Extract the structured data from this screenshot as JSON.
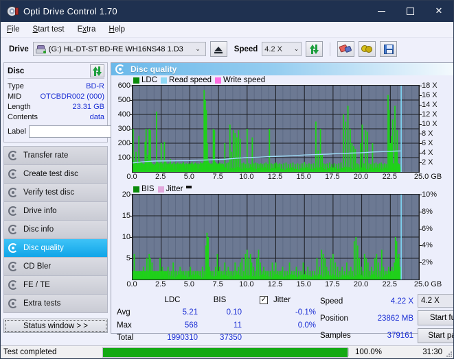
{
  "window": {
    "title": "Opti Drive Control 1.70",
    "icon": "disc-icon",
    "minimize": "–",
    "maximize": "□",
    "close": "✕"
  },
  "menu": {
    "items": [
      {
        "label": "File",
        "accel": "F"
      },
      {
        "label": "Start test",
        "accel": "S"
      },
      {
        "label": "Extra",
        "accel": "x"
      },
      {
        "label": "Help",
        "accel": "H"
      }
    ]
  },
  "toolbar": {
    "drive_label": "Drive",
    "drive_value": "(G:)  HL-DT-ST BD-RE  WH16NS48 1.D3",
    "eject_icon": "eject-icon",
    "speed_label": "Speed",
    "speed_value": "4.2 X",
    "refresh_icon": "refresh-icon",
    "erase_icon": "eraser-icon",
    "coins_icon": "coins-icon",
    "save_icon": "save-icon",
    "caret": "⌄"
  },
  "disc": {
    "header": "Disc",
    "refresh_icon": "refresh-icon",
    "fields": [
      {
        "key": "Type",
        "value": "BD-R"
      },
      {
        "key": "MID",
        "value": "OTCBDR002 (000)"
      },
      {
        "key": "Length",
        "value": "23.31 GB"
      },
      {
        "key": "Contents",
        "value": "data"
      }
    ],
    "label_key": "Label",
    "label_value": "",
    "label_placeholder": "",
    "disc_button_icon": "cd-icon"
  },
  "nav": {
    "items": [
      {
        "label": "Transfer rate",
        "selected": false
      },
      {
        "label": "Create test disc",
        "selected": false
      },
      {
        "label": "Verify test disc",
        "selected": false
      },
      {
        "label": "Drive info",
        "selected": false
      },
      {
        "label": "Disc info",
        "selected": false
      },
      {
        "label": "Disc quality",
        "selected": true
      },
      {
        "label": "CD Bler",
        "selected": false
      },
      {
        "label": "FE / TE",
        "selected": false
      },
      {
        "label": "Extra tests",
        "selected": false
      }
    ],
    "status_window": "Status window > >"
  },
  "panel": {
    "title": "Disc quality",
    "icon": "disc-quality-icon"
  },
  "chart_data": [
    {
      "type": "line",
      "title": "LDC / Read speed",
      "xlabel": "GB",
      "ylabel": "LDC",
      "y2label": "X",
      "xlim": [
        0,
        25
      ],
      "ylim": [
        0,
        600
      ],
      "y2lim": [
        0,
        18
      ],
      "grid": true,
      "legend_position": "top-left",
      "legend": [
        {
          "name": "LDC",
          "color": "#0a8a0a"
        },
        {
          "name": "Read speed",
          "color": "#8fd8f4"
        },
        {
          "name": "Write speed",
          "color": "#ff6ee0"
        }
      ],
      "xticks": [
        "0.0",
        "2.5",
        "5.0",
        "7.5",
        "10.0",
        "12.5",
        "15.0",
        "17.5",
        "20.0",
        "22.5",
        "25.0"
      ],
      "yticks": [
        100,
        200,
        300,
        400,
        500,
        600
      ],
      "y2ticks": [
        "2 X",
        "4 X",
        "6 X",
        "8 X",
        "10 X",
        "12 X",
        "14 X",
        "16 X",
        "18 X"
      ],
      "series": [
        {
          "name": "LDC",
          "color": "#1fd119",
          "render": "vertical-bars",
          "x": [
            0.05,
            0.12,
            0.2,
            0.3,
            0.38,
            0.45,
            0.55,
            0.62,
            0.72,
            0.8,
            0.9,
            1.0,
            1.1,
            1.18,
            1.25,
            1.35,
            1.45,
            1.55,
            1.62,
            1.7,
            1.8,
            1.9,
            2.0,
            2.1,
            2.2,
            2.3,
            2.42,
            2.5,
            2.55,
            2.65,
            2.78,
            2.9,
            3.0,
            3.1,
            3.2,
            3.3,
            3.4,
            3.5,
            3.62,
            3.72,
            3.85,
            3.95,
            4.05,
            4.15,
            4.25,
            4.35,
            4.45,
            4.55,
            4.68,
            4.78,
            4.9,
            5.0,
            5.1,
            5.2,
            5.3,
            5.42,
            5.5,
            5.6,
            5.72,
            5.85,
            5.95,
            6.05,
            6.15,
            6.25,
            6.35,
            6.45,
            6.52,
            6.58,
            6.65,
            6.75,
            6.85,
            6.95,
            7.05,
            7.15,
            7.25,
            7.35,
            7.45,
            7.55,
            7.62,
            7.72,
            7.82,
            7.92,
            8.05,
            8.2,
            8.35,
            8.5,
            8.65,
            8.8,
            8.95,
            9.1,
            9.25,
            9.4,
            9.55,
            9.7,
            9.85,
            10.0,
            10.15,
            10.3,
            10.45,
            10.6,
            10.75,
            10.9,
            11.05,
            11.2,
            11.35,
            11.5,
            11.65,
            11.8,
            11.95,
            12.1,
            12.25,
            12.4,
            12.55,
            12.7,
            12.85,
            13.0,
            13.2,
            13.4,
            13.6,
            13.8,
            14.0,
            14.2,
            14.4,
            14.6,
            14.8,
            15.0,
            15.2,
            15.4,
            15.6,
            15.8,
            16.0,
            16.2,
            16.4,
            16.55,
            16.7,
            16.85,
            17.0,
            17.2,
            17.4,
            17.6,
            17.8,
            18.0,
            18.2,
            18.4,
            18.6,
            18.8,
            19.0,
            19.15,
            19.3,
            19.45,
            19.6,
            19.75,
            19.9,
            20.05,
            20.2,
            20.35,
            20.5,
            20.65,
            20.8,
            20.95,
            21.1,
            21.25,
            21.4,
            21.55,
            21.7,
            21.85,
            22.0,
            22.15,
            22.3,
            22.4,
            22.5,
            22.6,
            22.7,
            22.8,
            22.9,
            23.0,
            23.1,
            23.2,
            23.3,
            23.4
          ],
          "values": [
            300,
            80,
            60,
            140,
            70,
            55,
            250,
            90,
            65,
            70,
            60,
            55,
            210,
            300,
            80,
            120,
            300,
            290,
            70,
            60,
            55,
            50,
            60,
            420,
            70,
            60,
            65,
            200,
            55,
            60,
            210,
            80,
            60,
            55,
            60,
            90,
            55,
            60,
            70,
            55,
            60,
            65,
            55,
            60,
            55,
            60,
            70,
            55,
            60,
            55,
            60,
            55,
            60,
            70,
            55,
            60,
            65,
            55,
            60,
            55,
            70,
            60,
            65,
            570,
            500,
            430,
            200,
            90,
            65,
            60,
            55,
            60,
            300,
            290,
            70,
            60,
            55,
            60,
            65,
            55,
            60,
            55,
            200,
            60,
            65,
            330,
            140,
            290,
            270,
            240,
            290,
            230,
            60,
            65,
            55,
            300,
            60,
            55,
            240,
            60,
            65,
            60,
            55,
            60,
            55,
            60,
            65,
            55,
            300,
            60,
            55,
            60,
            65,
            55,
            60,
            55,
            60,
            65,
            55,
            60,
            65,
            55,
            60,
            55,
            60,
            70,
            55,
            60,
            55,
            60,
            350,
            150,
            300,
            120,
            60,
            55,
            60,
            65,
            55,
            60,
            55,
            60,
            65,
            400,
            350,
            460,
            300,
            200,
            180,
            160,
            60,
            55,
            200,
            330,
            60,
            290,
            280,
            60,
            55,
            200,
            60,
            65,
            55,
            60,
            65,
            55,
            60,
            55,
            535,
            430,
            200,
            250,
            365,
            60,
            460,
            150,
            290,
            60,
            55
          ]
        },
        {
          "name": "Read speed",
          "color": "#9fdcf7",
          "render": "line",
          "x": [
            0.0,
            1.0,
            2.0,
            3.0,
            4.0,
            5.0,
            6.0,
            7.0,
            8.0,
            9.0,
            10.0,
            11.0,
            12.0,
            13.0,
            14.0,
            15.0,
            16.0,
            17.0,
            18.0,
            19.0,
            20.0,
            21.0,
            22.0,
            23.0,
            23.45
          ],
          "values": [
            63,
            72,
            76,
            77,
            78,
            79,
            82,
            85,
            88,
            95,
            100,
            103,
            107,
            110,
            113,
            118,
            121,
            124,
            128,
            131,
            134,
            139,
            142,
            145,
            146
          ]
        },
        {
          "name": "Scan cursor",
          "color": "#7fd9f7",
          "render": "vline",
          "x": [
            23.45
          ]
        }
      ]
    },
    {
      "type": "line",
      "title": "BIS / Jitter",
      "xlabel": "GB",
      "ylabel": "BIS",
      "y2label": "%",
      "xlim": [
        0,
        25
      ],
      "ylim": [
        0,
        20
      ],
      "y2lim": [
        0,
        10
      ],
      "grid": true,
      "legend_position": "top-left",
      "legend": [
        {
          "name": "BIS",
          "color": "#0a8a0a"
        },
        {
          "name": "Jitter",
          "color": "#e2a8dc"
        }
      ],
      "xticks": [
        "0.0",
        "2.5",
        "5.0",
        "7.5",
        "10.0",
        "12.5",
        "15.0",
        "17.5",
        "20.0",
        "22.5",
        "25.0"
      ],
      "yticks": [
        5,
        10,
        15,
        20
      ],
      "y2ticks": [
        "2%",
        "4%",
        "6%",
        "8%",
        "10%"
      ],
      "series": [
        {
          "name": "BIS",
          "color": "#1fd119",
          "render": "vertical-bars",
          "x": [
            0.05,
            0.15,
            0.25,
            0.35,
            0.45,
            0.55,
            0.65,
            0.75,
            0.85,
            0.95,
            1.05,
            1.15,
            1.25,
            1.35,
            1.45,
            1.55,
            1.62,
            1.7,
            1.8,
            1.9,
            2.0,
            2.1,
            2.2,
            2.3,
            2.4,
            2.5,
            2.6,
            2.7,
            2.8,
            2.9,
            3.0,
            3.1,
            3.25,
            3.4,
            3.55,
            3.7,
            3.85,
            4.0,
            4.15,
            4.3,
            4.45,
            4.6,
            4.75,
            4.9,
            5.05,
            5.2,
            5.35,
            5.5,
            5.65,
            5.8,
            5.95,
            6.1,
            6.25,
            6.4,
            6.5,
            6.55,
            6.6,
            6.7,
            6.8,
            6.95,
            7.1,
            7.25,
            7.4,
            7.5,
            7.6,
            7.75,
            7.9,
            8.05,
            8.2,
            8.35,
            8.5,
            8.65,
            8.8,
            8.95,
            9.1,
            9.25,
            9.4,
            9.55,
            9.7,
            9.85,
            10.0,
            10.15,
            10.3,
            10.4,
            10.55,
            10.7,
            10.85,
            11.0,
            11.15,
            11.3,
            11.45,
            11.6,
            11.75,
            11.9,
            12.05,
            12.2,
            12.35,
            12.5,
            12.65,
            12.8,
            12.95,
            13.1,
            13.3,
            13.5,
            13.7,
            13.9,
            14.1,
            14.3,
            14.5,
            14.7,
            14.9,
            15.1,
            15.3,
            15.5,
            15.7,
            15.9,
            16.1,
            16.3,
            16.5,
            16.65,
            16.8,
            16.95,
            17.1,
            17.3,
            17.5,
            17.7,
            17.9,
            18.1,
            18.3,
            18.5,
            18.7,
            18.9,
            19.05,
            19.2,
            19.35,
            19.5,
            19.65,
            19.8,
            19.95,
            20.1,
            20.25,
            20.4,
            20.55,
            20.7,
            20.85,
            21.0,
            21.15,
            21.3,
            21.45,
            21.6,
            21.75,
            21.9,
            22.05,
            22.2,
            22.35,
            22.45,
            22.55,
            22.65,
            22.75,
            22.85,
            22.95,
            23.05,
            23.15,
            23.25,
            23.35,
            23.42
          ],
          "values": [
            2,
            6,
            2,
            2,
            2,
            2,
            2,
            2,
            2,
            3,
            2,
            2,
            5,
            2,
            6,
            5,
            2,
            4,
            2,
            2,
            2,
            2,
            2,
            2,
            5,
            2,
            3,
            2,
            2,
            2,
            2,
            3,
            2,
            2,
            4,
            2,
            2,
            2,
            3,
            2,
            2,
            2,
            2,
            2,
            3,
            2,
            2,
            2,
            2,
            2,
            2,
            3,
            2,
            8,
            11,
            9,
            10,
            3,
            2,
            2,
            2,
            3,
            6,
            2,
            3,
            2,
            2,
            4,
            2,
            3,
            2,
            2,
            2,
            4,
            2,
            3,
            4,
            5,
            2,
            6,
            7,
            5,
            6,
            4,
            3,
            2,
            5,
            7,
            4,
            2,
            3,
            2,
            2,
            2,
            2,
            4,
            2,
            4,
            2,
            2,
            2,
            3,
            2,
            2,
            4,
            2,
            2,
            3,
            2,
            2,
            4,
            2,
            3,
            2,
            2,
            2,
            5,
            3,
            7,
            6,
            5,
            3,
            2,
            5,
            6,
            4,
            3,
            2,
            3,
            2,
            4,
            2,
            3,
            2,
            9,
            10,
            8,
            5,
            3,
            2,
            6,
            5,
            4,
            2,
            3,
            2,
            5,
            6,
            4,
            2,
            7,
            3,
            2,
            2,
            3,
            2,
            2,
            3,
            2,
            4,
            10,
            9,
            5,
            6,
            3,
            2,
            9,
            5,
            7,
            3,
            2
          ]
        },
        {
          "name": "Scan cursor",
          "color": "#7fd9f7",
          "render": "vline",
          "x": [
            23.45
          ]
        }
      ]
    }
  ],
  "stats": {
    "col_headers": [
      "LDC",
      "BIS"
    ],
    "jitter_label": "Jitter",
    "jitter_checked": true,
    "rows": [
      {
        "label": "Avg",
        "ldc": "5.21",
        "bis": "0.10",
        "jitter": "-0.1%"
      },
      {
        "label": "Max",
        "ldc": "568",
        "bis": "11",
        "jitter": "0.0%"
      },
      {
        "label": "Total",
        "ldc": "1990310",
        "bis": "37350",
        "jitter": ""
      }
    ],
    "speed_label": "Speed",
    "speed_value": "4.22 X",
    "position_label": "Position",
    "position_value": "23862 MB",
    "samples_label": "Samples",
    "samples_value": "379161",
    "speed_select": "4.2 X",
    "start_full": "Start full",
    "start_part": "Start part",
    "caret": "⌄"
  },
  "statusbar": {
    "text": "Test completed",
    "progress_percent": 100,
    "percent_label": "100.0%",
    "time": "31:30"
  }
}
